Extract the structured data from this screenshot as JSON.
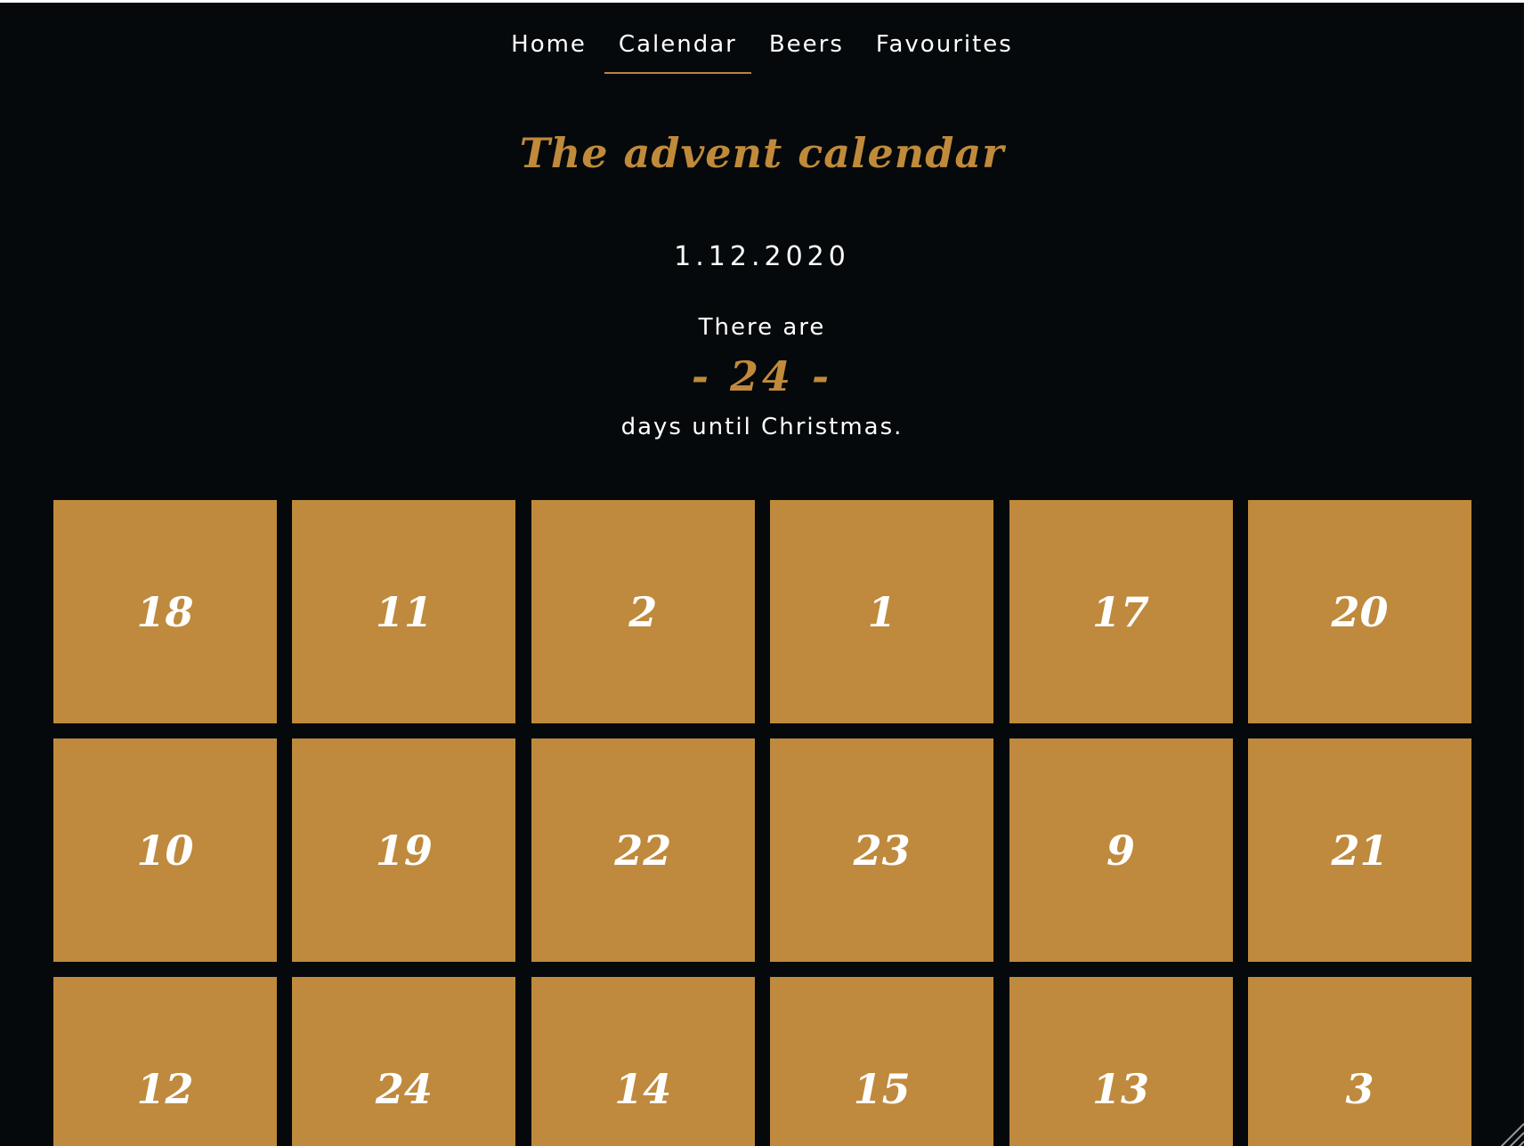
{
  "nav": {
    "items": [
      {
        "label": "Home",
        "active": false
      },
      {
        "label": "Calendar",
        "active": true
      },
      {
        "label": "Beers",
        "active": false
      },
      {
        "label": "Favourites",
        "active": false
      }
    ]
  },
  "main": {
    "title": "The advent calendar",
    "date": "1.12.2020",
    "countdown_prefix": "There are",
    "countdown_value": "- 24 -",
    "countdown_suffix": "days until Christmas."
  },
  "calendar": {
    "doors": [
      "18",
      "11",
      "2",
      "1",
      "17",
      "20",
      "10",
      "19",
      "22",
      "23",
      "9",
      "21",
      "12",
      "24",
      "14",
      "15",
      "13",
      "3"
    ]
  },
  "colors": {
    "background": "#05090b",
    "accent": "#bf8a3d",
    "text": "#ffffff"
  },
  "icons": {
    "resize": "resize-grip-icon"
  }
}
